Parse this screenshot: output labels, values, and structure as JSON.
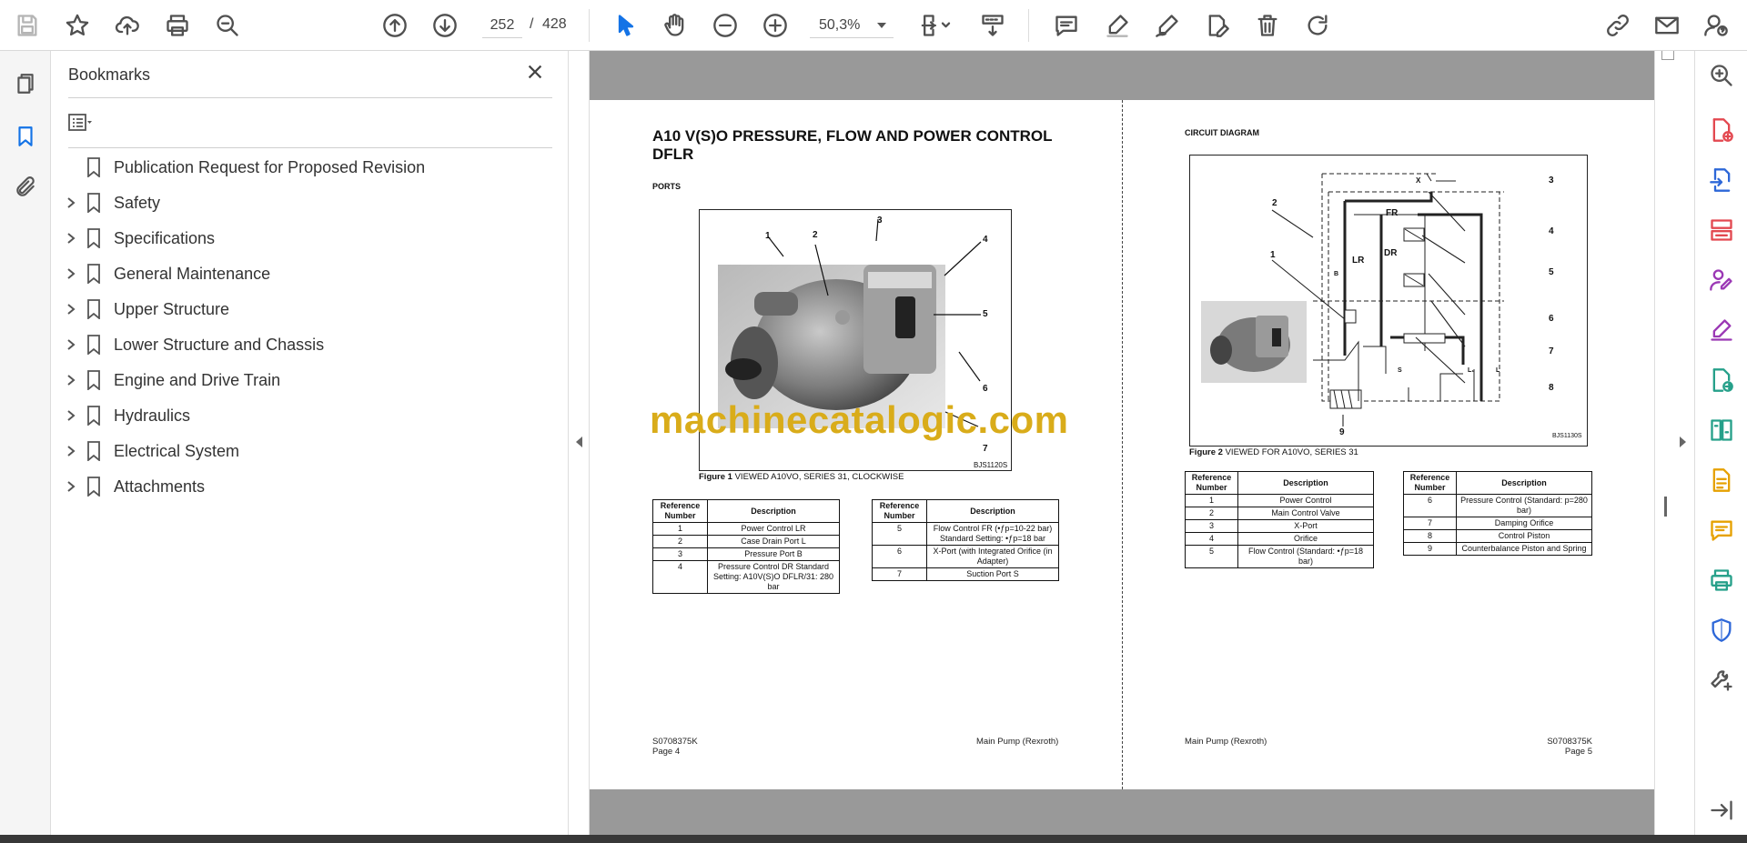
{
  "toolbar": {
    "current_page": "252",
    "page_separator": "/",
    "total_pages": "428",
    "zoom": "50,3%"
  },
  "bookmarks": {
    "title": "Bookmarks",
    "items": [
      {
        "label": "Publication Request for Proposed Revision",
        "expandable": false
      },
      {
        "label": "Safety",
        "expandable": true
      },
      {
        "label": "Specifications",
        "expandable": true
      },
      {
        "label": "General Maintenance",
        "expandable": true
      },
      {
        "label": "Upper Structure",
        "expandable": true
      },
      {
        "label": "Lower Structure and Chassis",
        "expandable": true
      },
      {
        "label": "Engine and Drive Train",
        "expandable": true
      },
      {
        "label": "Hydraulics",
        "expandable": true
      },
      {
        "label": "Electrical System",
        "expandable": true
      },
      {
        "label": "Attachments",
        "expandable": true
      }
    ]
  },
  "left_page": {
    "title": "A10 V(S)O PRESSURE, FLOW AND POWER CONTROL DFLR",
    "section": "PORTS",
    "figure_label": "Figure 1",
    "figure_caption": "VIEWED A10VO, SERIES 31, CLOCKWISE",
    "image_code": "BJS1120S",
    "callouts": [
      "1",
      "2",
      "3",
      "4",
      "5",
      "6",
      "7"
    ],
    "table_header": {
      "ref": "Reference Number",
      "desc": "Description"
    },
    "table_a": [
      {
        "ref": "1",
        "desc": "Power Control LR"
      },
      {
        "ref": "2",
        "desc": "Case Drain Port L"
      },
      {
        "ref": "3",
        "desc": "Pressure Port B"
      },
      {
        "ref": "4",
        "desc": "Pressure Control DR Standard Setting: A10V(S)O DFLR/31: 280 bar"
      }
    ],
    "table_b": [
      {
        "ref": "5",
        "desc": "Flow Control FR (•ƒp=10-22 bar) Standard Setting: •ƒp=18 bar"
      },
      {
        "ref": "6",
        "desc": "X-Port (with Integrated Orifice (in Adapter)"
      },
      {
        "ref": "7",
        "desc": "Suction Port S"
      }
    ],
    "footer_code": "S0708375K",
    "footer_page": "Page 4",
    "footer_title": "Main Pump (Rexroth)"
  },
  "right_page": {
    "section": "CIRCUIT DIAGRAM",
    "figure_label": "Figure 2",
    "figure_caption": "VIEWED FOR A10VO, SERIES 31",
    "image_code": "BJS1130S",
    "labels": {
      "fr": "FR",
      "dr": "DR",
      "lr": "LR",
      "b": "B",
      "x": "X",
      "s": "S",
      "l1": "L₁",
      "l": "L"
    },
    "callouts": [
      "1",
      "2",
      "3",
      "4",
      "5",
      "6",
      "7",
      "8",
      "9"
    ],
    "table_a": [
      {
        "ref": "1",
        "desc": "Power Control"
      },
      {
        "ref": "2",
        "desc": "Main Control Valve"
      },
      {
        "ref": "3",
        "desc": "X-Port"
      },
      {
        "ref": "4",
        "desc": "Orifice"
      },
      {
        "ref": "5",
        "desc": "Flow Control (Standard: •ƒp=18 bar)"
      }
    ],
    "table_b": [
      {
        "ref": "6",
        "desc": "Pressure Control (Standard: p=280 bar)"
      },
      {
        "ref": "7",
        "desc": "Damping Orifice"
      },
      {
        "ref": "8",
        "desc": "Control Piston"
      },
      {
        "ref": "9",
        "desc": "Counterbalance Piston and Spring"
      }
    ],
    "footer_title": "Main Pump (Rexroth)",
    "footer_code": "S0708375K",
    "footer_page": "Page 5"
  },
  "watermark": "machinecatalogic.com",
  "colors": {
    "accent": "#1473e6",
    "watermark": "#d9ac1a",
    "canvas": "#999999"
  }
}
